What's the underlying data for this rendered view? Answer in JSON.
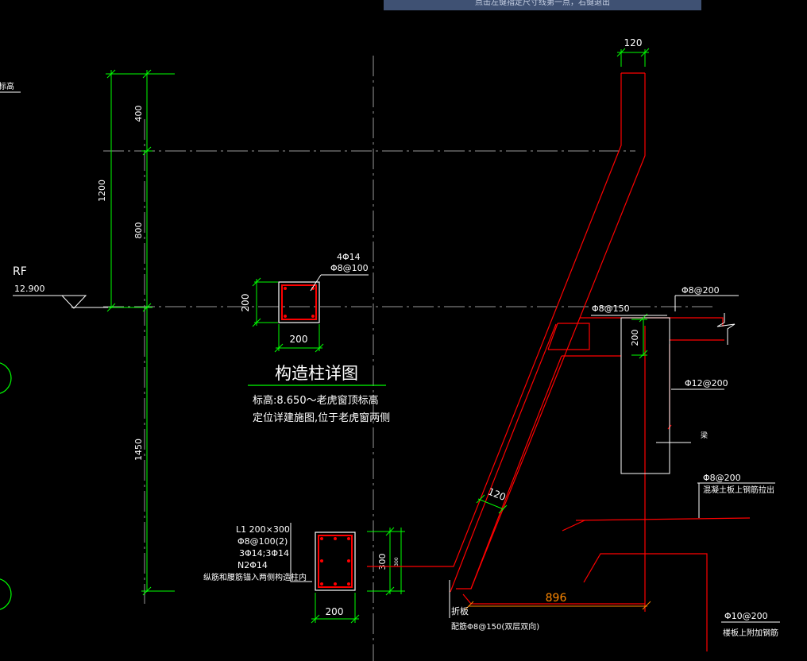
{
  "banner": {
    "text": "点击左键指定尺寸线第一点，右键退出"
  },
  "level": {
    "name": "RF",
    "elevation": "12.900"
  },
  "left_dims": {
    "total_top": "1200",
    "d400": "400",
    "d800": "800",
    "d1450": "1450"
  },
  "cutoff_left_text": "标高",
  "column_detail": {
    "rebar_main": "4Φ14",
    "rebar_stirrup": "Φ8@100",
    "height": "200",
    "width": "200",
    "title": "构造柱详图",
    "note_line1": "标高:8.650～老虎窗顶标高",
    "note_line2": "定位详建施图,位于老虎窗两侧"
  },
  "beam_L1": {
    "line1": "L1 200×300",
    "line2": "Φ8@100(2)",
    "line3": "3Φ14;3Φ14",
    "line4": "N2Φ14",
    "line5": "纵筋和腰筋锚入两侧构造柱内",
    "height_dim": "300",
    "height_dim_small": "300",
    "width_dim": "200"
  },
  "section": {
    "top_width": "120",
    "slope_thickness": "120",
    "bottom_span": "896",
    "bar_phi8_150": "Φ8@150",
    "bar_phi8_200_top": "Φ8@200",
    "beam_depth": "200",
    "bar_phi12_200": "Φ12@200",
    "beam_label": "梁",
    "bar_phi8_200_right": "Φ8@200",
    "note_right": "混凝土板上钢筋拉出",
    "slab_label": "折板",
    "slab_rebar": "配筋Φ8@150(双层双向)",
    "bar_phi10_200": "Φ10@200",
    "note_phi10": "楼板上附加钢筋"
  },
  "colors": {
    "background": "#000000",
    "dimension": "#00ff00",
    "concrete": "#ff0000",
    "text": "#ffffff",
    "centerline": "#9a9a9a",
    "banner": "#3f5173"
  }
}
